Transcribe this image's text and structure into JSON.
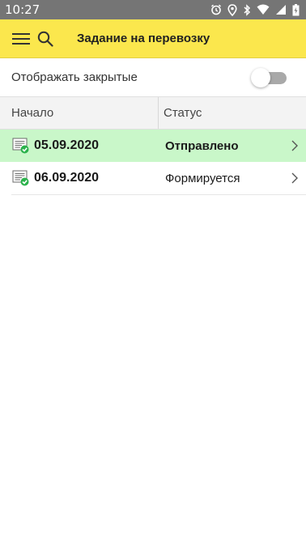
{
  "status_bar": {
    "time": "10:27",
    "icons": [
      "alarm-icon",
      "location-icon",
      "bluetooth-icon",
      "wifi-icon",
      "signal-icon",
      "battery-icon"
    ],
    "background": "#757575"
  },
  "app_bar": {
    "title": "Задание на перевозку",
    "background": "#fbe74d",
    "icons": [
      "hamburger-menu-icon",
      "search-icon"
    ]
  },
  "filter": {
    "show_closed_label": "Отображать закрытые",
    "show_closed_value": false
  },
  "table": {
    "columns": [
      "Начало",
      "Статус"
    ],
    "rows": [
      {
        "start": "05.09.2020",
        "status": "Отправлено",
        "selected": true,
        "icon": "document-checked-icon"
      },
      {
        "start": "06.09.2020",
        "status": "Формируется",
        "selected": false,
        "icon": "document-checked-icon"
      }
    ],
    "selected_row_color": "#c9f7c9"
  }
}
